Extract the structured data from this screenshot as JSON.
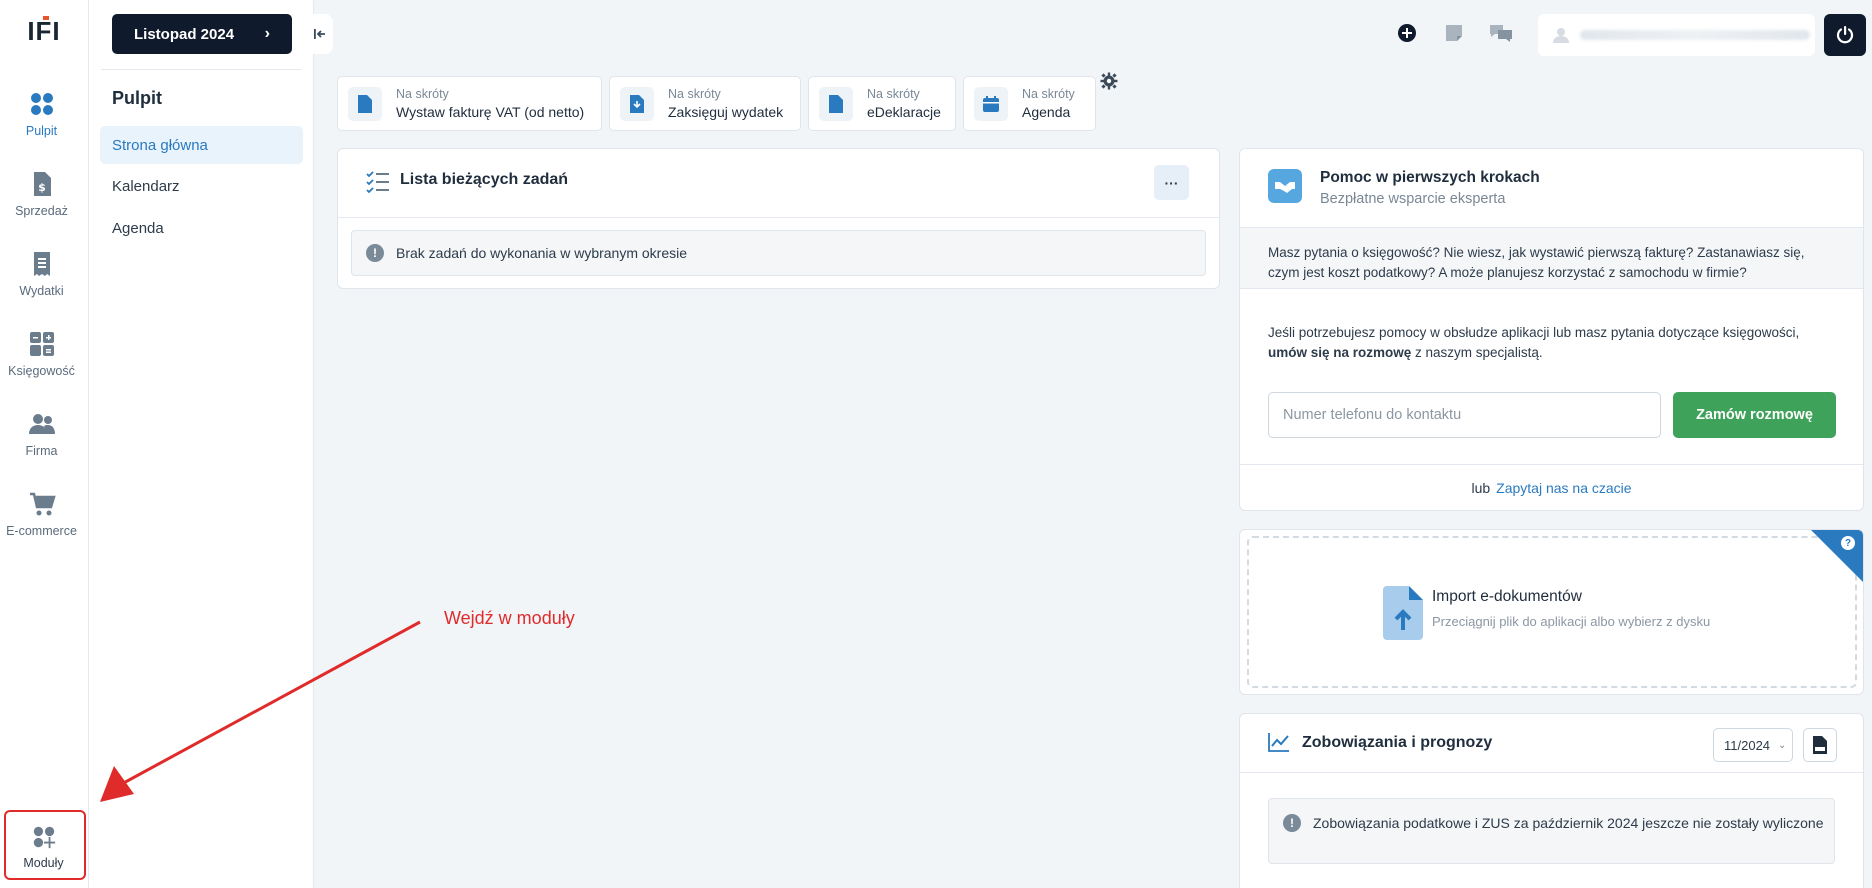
{
  "rail": {
    "logo": "IFI",
    "items": [
      {
        "label": "Pulpit"
      },
      {
        "label": "Sprzedaż"
      },
      {
        "label": "Wydatki"
      },
      {
        "label": "Księgowość"
      },
      {
        "label": "Firma"
      },
      {
        "label": "E-commerce"
      }
    ],
    "modules_label": "Moduły"
  },
  "sidebar": {
    "period": "Listopad 2024",
    "title": "Pulpit",
    "items": [
      {
        "label": "Strona główna"
      },
      {
        "label": "Kalendarz"
      },
      {
        "label": "Agenda"
      }
    ]
  },
  "shortcuts": [
    {
      "small": "Na skróty",
      "label": "Wystaw fakturę VAT (od netto)"
    },
    {
      "small": "Na skróty",
      "label": "Zaksięguj wydatek"
    },
    {
      "small": "Na skróty",
      "label": "eDeklaracje"
    },
    {
      "small": "Na skróty",
      "label": "Agenda"
    }
  ],
  "tasks": {
    "title": "Lista bieżących zadań",
    "more": "···",
    "empty": "Brak zadań do wykonania w wybranym okresie"
  },
  "help": {
    "title": "Pomoc w pierwszych krokach",
    "subtitle": "Bezpłatne wsparcie eksperta",
    "band": "Masz pytania o księgowość? Nie wiesz, jak wystawić pierwszą fakturę? Zastanawiasz się, czym jest koszt podatkowy? A może planujesz korzystać z samochodu w firmie?",
    "text_before": "Jeśli potrzebujesz pomocy w obsłudze aplikacji lub masz pytania dotyczące księgowości, ",
    "text_bold": "umów się na rozmowę",
    "text_after": " z naszym specjalistą.",
    "phone_placeholder": "Numer telefonu do kontaktu",
    "order_button": "Zamów rozmowę",
    "or": "lub",
    "chat_link": "Zapytaj nas na czacie"
  },
  "import": {
    "title": "Import e-dokumentów",
    "subtitle": "Przeciągnij plik do aplikacji albo wybierz z dysku",
    "help": "?"
  },
  "obligations": {
    "title": "Zobowiązania i prognozy",
    "period": "11/2024",
    "info": "Zobowiązania podatkowe i ZUS za październik 2024 jeszcze nie zostały wyliczone"
  },
  "annotation": {
    "text": "Wejdź w moduły"
  },
  "colors": {
    "accent": "#2a7abf",
    "dark": "#0f1b2c",
    "green": "#3fa25a",
    "annotation": "#e02b2b"
  }
}
